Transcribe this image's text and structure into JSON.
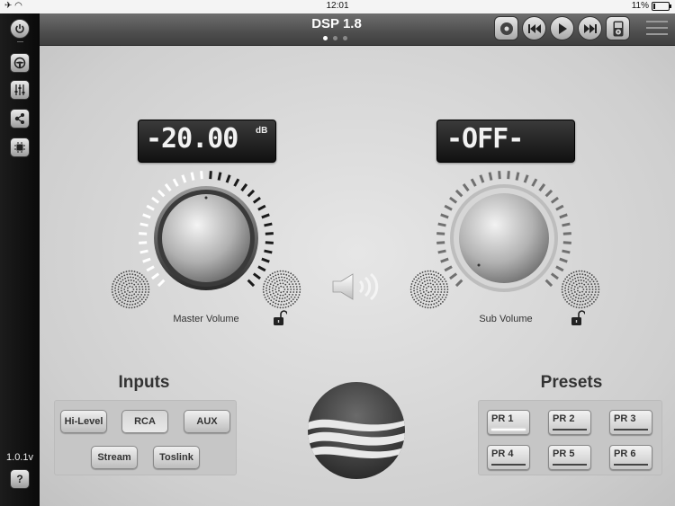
{
  "status_bar": {
    "time": "12:01",
    "battery_percent": "11%",
    "battery_level": 0.11
  },
  "header": {
    "title": "DSP 1.8",
    "page_dots": {
      "count": 3,
      "active": 0
    },
    "transport_icons": [
      "disc-icon",
      "previous-icon",
      "play-icon",
      "next-icon",
      "ipod-icon",
      "menu-icon"
    ]
  },
  "sidebar": {
    "items": [
      "power-icon",
      "steering-wheel-icon",
      "equalizer-sliders-icon",
      "share-nodes-icon",
      "chip-icon"
    ],
    "version": "1.0.1v",
    "help_label": "?"
  },
  "master": {
    "display": "-20.00",
    "unit": "dB",
    "label": "Master Volume",
    "level": 0.5,
    "locked": false
  },
  "sub": {
    "display": "-OFF-",
    "label": "Sub Volume",
    "level": 0.0,
    "locked": false
  },
  "center_icon": "speaker-volume-icon",
  "inputs": {
    "title": "Inputs",
    "buttons": [
      "Hi-Level",
      "RCA",
      "AUX",
      "Stream",
      "Toslink"
    ],
    "selected": "RCA"
  },
  "presets": {
    "title": "Presets",
    "buttons": [
      "PR 1",
      "PR 2",
      "PR 3",
      "PR 4",
      "PR 5",
      "PR 6"
    ],
    "selected": "PR 1"
  },
  "colors": {
    "background": "#d8d8d8",
    "sidebar": "#111111",
    "header": "#5a5a5a",
    "lcd": "#1e1e1e"
  }
}
